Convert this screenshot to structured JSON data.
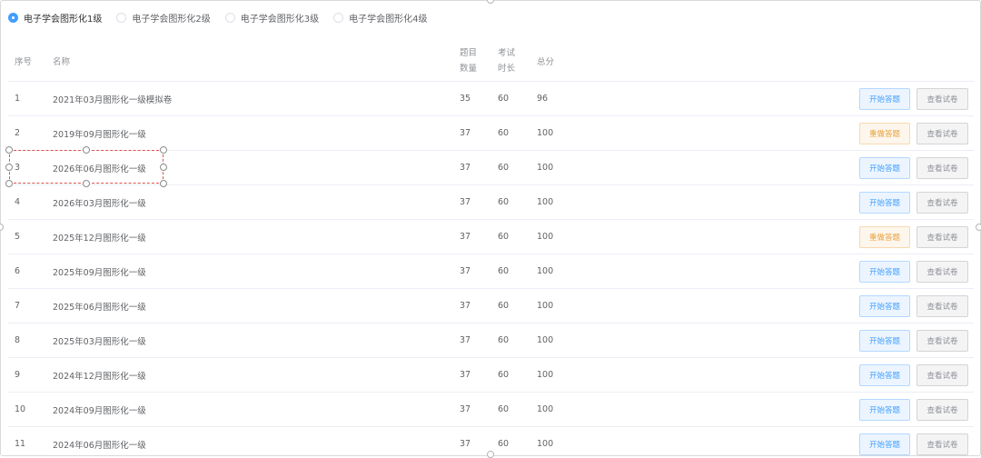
{
  "tabs": [
    {
      "label": "电子学会图形化1级",
      "checked": true
    },
    {
      "label": "电子学会图形化2级",
      "checked": false
    },
    {
      "label": "电子学会图形化3级",
      "checked": false
    },
    {
      "label": "电子学会图形化4级",
      "checked": false
    }
  ],
  "table": {
    "headers": {
      "index": "序号",
      "name": "名称",
      "question_count_line1": "题目",
      "question_count_line2": "数量",
      "duration_line1": "考试",
      "duration_line2": "时长",
      "score": "总分"
    },
    "rows": [
      {
        "index": "1",
        "name": "2021年03月图形化一级模拟卷",
        "questions": "35",
        "duration": "60",
        "score": "96",
        "action": "开始答题",
        "action_type": "start",
        "view": "查看试卷"
      },
      {
        "index": "2",
        "name": "2019年09月图形化一级",
        "questions": "37",
        "duration": "60",
        "score": "100",
        "action": "重做答题",
        "action_type": "redo",
        "view": "查看试卷"
      },
      {
        "index": "3",
        "name": "2026年06月图形化一级",
        "questions": "37",
        "duration": "60",
        "score": "100",
        "action": "开始答题",
        "action_type": "start",
        "view": "查看试卷"
      },
      {
        "index": "4",
        "name": "2026年03月图形化一级",
        "questions": "37",
        "duration": "60",
        "score": "100",
        "action": "开始答题",
        "action_type": "start",
        "view": "查看试卷"
      },
      {
        "index": "5",
        "name": "2025年12月图形化一级",
        "questions": "37",
        "duration": "60",
        "score": "100",
        "action": "重做答题",
        "action_type": "redo",
        "view": "查看试卷"
      },
      {
        "index": "6",
        "name": "2025年09月图形化一级",
        "questions": "37",
        "duration": "60",
        "score": "100",
        "action": "开始答题",
        "action_type": "start",
        "view": "查看试卷"
      },
      {
        "index": "7",
        "name": "2025年06月图形化一级",
        "questions": "37",
        "duration": "60",
        "score": "100",
        "action": "开始答题",
        "action_type": "start",
        "view": "查看试卷"
      },
      {
        "index": "8",
        "name": "2025年03月图形化一级",
        "questions": "37",
        "duration": "60",
        "score": "100",
        "action": "开始答题",
        "action_type": "start",
        "view": "查看试卷"
      },
      {
        "index": "9",
        "name": "2024年12月图形化一级",
        "questions": "37",
        "duration": "60",
        "score": "100",
        "action": "开始答题",
        "action_type": "start",
        "view": "查看试卷"
      },
      {
        "index": "10",
        "name": "2024年09月图形化一级",
        "questions": "37",
        "duration": "60",
        "score": "100",
        "action": "开始答题",
        "action_type": "start",
        "view": "查看试卷"
      },
      {
        "index": "11",
        "name": "2024年06月图形化一级",
        "questions": "37",
        "duration": "60",
        "score": "100",
        "action": "开始答题",
        "action_type": "start",
        "view": "查看试卷"
      }
    ]
  },
  "colors": {
    "accent": "#409eff",
    "warning": "#e6a23c",
    "selection": "#d9534f"
  }
}
